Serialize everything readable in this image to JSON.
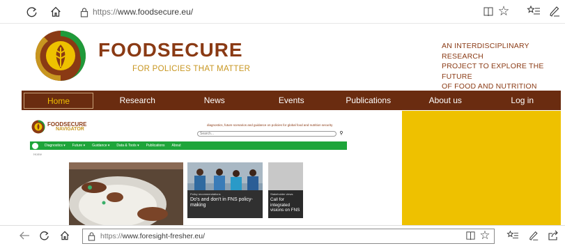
{
  "browser_top": {
    "url_prefix": "https://",
    "url_domain": "www.foodsecure.eu/",
    "icons": [
      "refresh-icon",
      "home-icon",
      "lock-icon",
      "reading-view-icon",
      "favorite-star-icon",
      "favorites-list-icon",
      "pen-icon"
    ]
  },
  "site": {
    "brand": "FOODSECURE",
    "slogan": "FOR POLICIES THAT MATTER",
    "tagline": [
      "AN INTERDISCIPLINARY RESEARCH",
      "PROJECT TO EXPLORE THE FUTURE",
      "OF FOOD AND NUTRITION SECURITY"
    ],
    "nav": [
      {
        "label": "Home",
        "active": true
      },
      {
        "label": "Research"
      },
      {
        "label": "News"
      },
      {
        "label": "Events"
      },
      {
        "label": "Publications"
      },
      {
        "label": "About us"
      },
      {
        "label": "Log in"
      }
    ],
    "colors": {
      "brand": "#8a3a14",
      "nav_bg": "#6a2c10",
      "accent_gold": "#c89620",
      "yellow_panel": "#eec100"
    }
  },
  "navigator": {
    "brand_line1": "FOODSECURE",
    "brand_line2": "NAVIGATOR",
    "description": "diagnostics, future scenarios and guidance on policies for global food and nutrition security",
    "search_placeholder": "Search...",
    "nav": [
      "Diagnostics ▾",
      "Future ▾",
      "Guidance ▾",
      "Data & Tools ▾",
      "Publications",
      "About"
    ],
    "breadcrumb": "Home",
    "card1": {
      "small": "Policy recommendations",
      "title": "Do's and don't in FNS policy-making"
    },
    "card2": {
      "small": "Stakeholder views",
      "title": "Call for integrated visions on FNS"
    },
    "nav_color": "#1ea53a"
  },
  "browser_bottom": {
    "url_prefix": "https://",
    "url_domain": "www.foresight-fresher.eu/",
    "icons": [
      "back-arrow-icon",
      "refresh-icon",
      "home-icon",
      "lock-icon",
      "reading-view-icon",
      "favorite-star-icon",
      "favorites-list-icon",
      "pen-icon",
      "share-icon"
    ]
  }
}
